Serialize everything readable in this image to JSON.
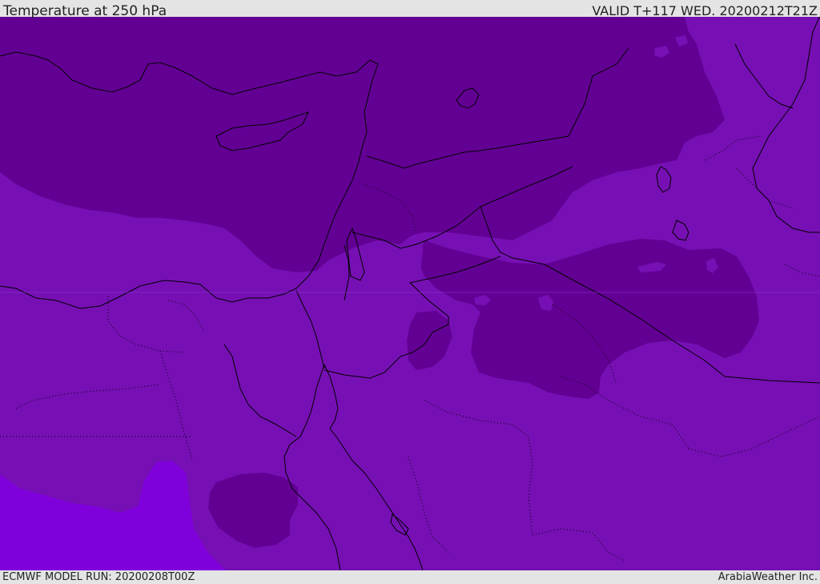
{
  "header": {
    "title": "Temperature at 250 hPa",
    "valid": "VALID T+117 WED. 20200212T21Z"
  },
  "footer": {
    "model_run": "ECMWF MODEL RUN: 20200208T00Z",
    "credit": "ArabiaWeather Inc."
  },
  "map": {
    "colors": {
      "coldest_band": "#630094",
      "cold_band": "#7610b4",
      "mild_band": "#8000dc",
      "boundary_lines": "#000000"
    }
  }
}
